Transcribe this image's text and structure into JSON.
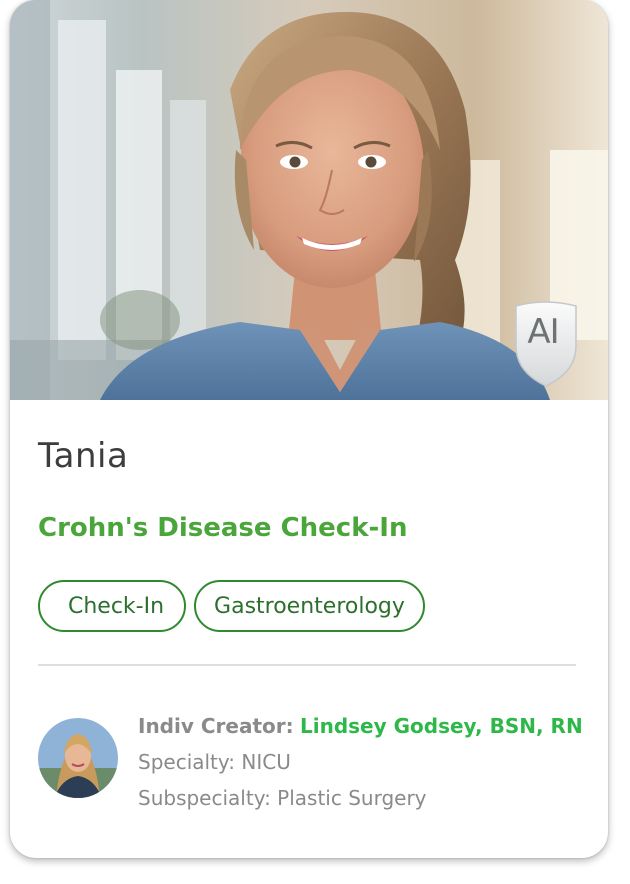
{
  "card": {
    "name": "Tania",
    "ai_badge": "AI",
    "title": "Crohn's Disease Check-In",
    "tags": [
      "Check-In",
      "Gastroenterology"
    ],
    "colors": {
      "accent_green": "#4aa53a",
      "tag_border": "#2f8a2f",
      "creator_green": "#2fb84a"
    }
  },
  "creator": {
    "label": "Indiv Creator:",
    "name": "Lindsey Godsey, BSN, RN",
    "specialty": "Specialty: NICU",
    "subspecialty": "Subspecialty: Plastic Surgery"
  }
}
